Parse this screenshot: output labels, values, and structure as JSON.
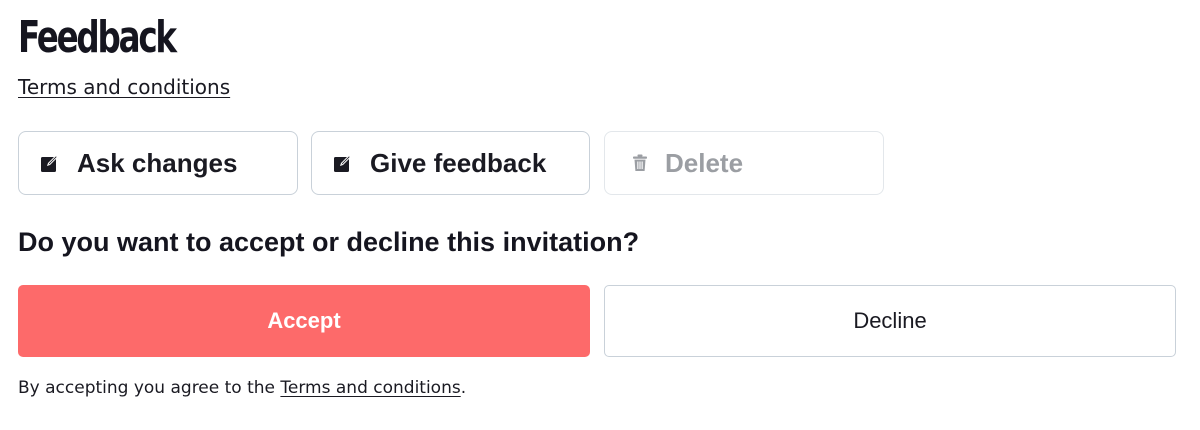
{
  "header": {
    "title": "Feedback",
    "terms_link": "Terms and conditions"
  },
  "actions": {
    "ask_changes": {
      "label": "Ask changes",
      "icon": "edit-icon"
    },
    "give_feedback": {
      "label": "Give feedback",
      "icon": "edit-icon"
    },
    "delete": {
      "label": "Delete",
      "icon": "trash-icon",
      "disabled": true
    }
  },
  "invitation": {
    "question": "Do you want to accept or decline this invitation?",
    "accept_label": "Accept",
    "decline_label": "Decline"
  },
  "footer": {
    "prefix": "By accepting you agree to the ",
    "link": "Terms and conditions",
    "suffix": "."
  },
  "colors": {
    "accent": "#fd6a6a",
    "text": "#1a1a22",
    "border": "#c9d1d9",
    "disabled_text": "#9b9ea3"
  }
}
